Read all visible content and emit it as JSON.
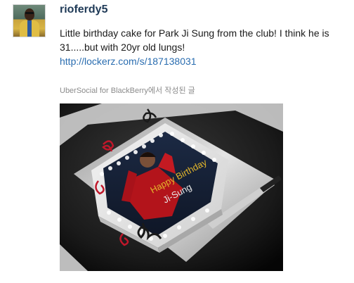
{
  "post": {
    "username": "rioferdy5",
    "text": "Little birthday cake for Park Ji Sung from the club! I think he is 31.....but with 20yr old lungs!",
    "link": "http://lockerz.com/s/187138031",
    "source": "UberSocial for BlackBerry에서 작성된 글"
  },
  "photo": {
    "cake_text_line1": "Happy Birthday",
    "cake_text_line2": "Ji-Sung"
  },
  "colors": {
    "username": "#1f3a57",
    "link": "#2a6db0",
    "source": "#8b8b8b"
  }
}
